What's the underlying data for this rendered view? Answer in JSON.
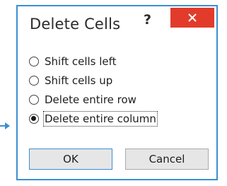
{
  "dialog": {
    "title": "Delete Cells",
    "help_label": "?",
    "close_icon": "close-icon",
    "accent_color": "#3b8fd2",
    "close_color": "#e23b2c"
  },
  "options": [
    {
      "label": "Shift cells left",
      "checked": false
    },
    {
      "label": "Shift cells up",
      "checked": false
    },
    {
      "label": "Delete entire row",
      "checked": false
    },
    {
      "label": "Delete entire column",
      "checked": true
    }
  ],
  "buttons": {
    "ok_label": "OK",
    "cancel_label": "Cancel"
  },
  "pointer": {
    "icon": "arrow-right-icon",
    "color": "#3b8fd2"
  }
}
